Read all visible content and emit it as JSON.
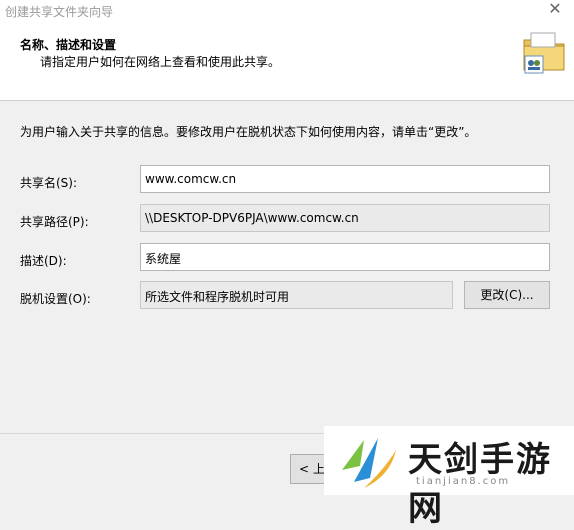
{
  "window": {
    "title": "创建共享文件夹向导",
    "close_glyph": "✕"
  },
  "header": {
    "title": "名称、描述和设置",
    "subtitle": "请指定用户如何在网络上查看和使用此共享。",
    "folder_icon": "shared-folder-icon"
  },
  "main": {
    "instruction": "为用户输入关于共享的信息。要修改用户在脱机状态下如何使用内容，请单击“更改”。",
    "share_name": {
      "label": "共享名(S):",
      "value": "www.comcw.cn"
    },
    "share_path": {
      "label": "共享路径(P):",
      "value": "\\\\DESKTOP-DPV6PJA\\www.comcw.cn"
    },
    "description": {
      "label": "描述(D):",
      "value": "系统屋"
    },
    "offline": {
      "label": "脱机设置(O):",
      "value": "所选文件和程序脱机时可用",
      "change_button": "更改(C)..."
    }
  },
  "footer": {
    "back_button": "< 上"
  },
  "watermark": {
    "text": "天剑手游网",
    "url": "tianjian8.com"
  },
  "colors": {
    "window_bg": "#f0f0f0",
    "header_bg": "#ffffff",
    "readonly_bg": "#eaeaea"
  }
}
